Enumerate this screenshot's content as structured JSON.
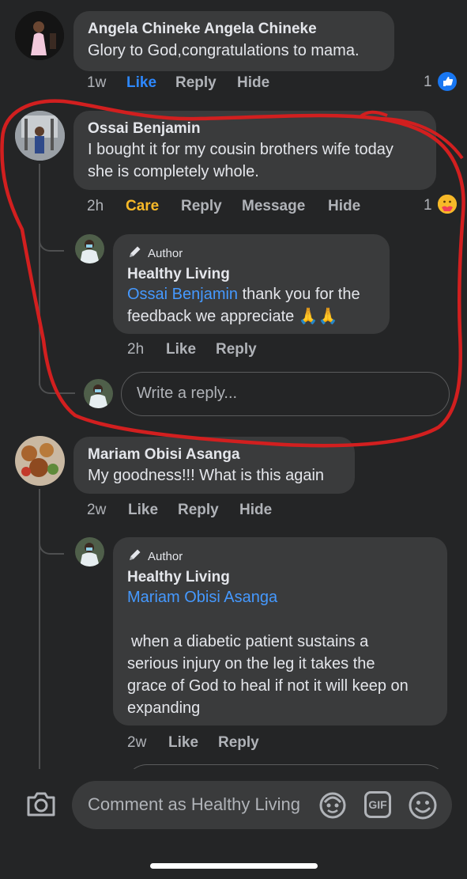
{
  "comments": {
    "c1": {
      "name": "Angela Chineke Angela Chineke",
      "text": "Glory to God,congratulations to mama.",
      "time": "1w",
      "like": "Like",
      "reply": "Reply",
      "hide": "Hide",
      "reaction_count": "1"
    },
    "c2": {
      "name": "Ossai Benjamin",
      "line1": "I bought it for my cousin brothers wife today",
      "line2": "she is completely whole.",
      "time": "2h",
      "care": "Care",
      "reply": "Reply",
      "message": "Message",
      "hide": "Hide",
      "reaction_count": "1"
    },
    "r1": {
      "author_tag": "Author",
      "name": "Healthy Living",
      "mention": "Ossai Benjamin",
      "text_a": " thank you for the",
      "text_b": "feedback we appreciate",
      "emoji": "🙏🙏",
      "time": "2h",
      "like": "Like",
      "reply": "Reply"
    },
    "write_reply": {
      "placeholder": "Write a reply..."
    },
    "c3": {
      "name": "Mariam Obisi Asanga",
      "text": "My goodness!!! What is this again",
      "time": "2w",
      "like": "Like",
      "reply": "Reply",
      "hide": "Hide"
    },
    "r2": {
      "author_tag": "Author",
      "name": "Healthy Living",
      "mention": "Mariam Obisi Asanga",
      "line1": "when a diabetic patient sustains a",
      "line2": "serious injury on the leg it takes the",
      "line3": "grace of God to heal if not it will keep on",
      "line4": "expanding",
      "time": "2w",
      "like": "Like",
      "reply": "Reply"
    }
  },
  "composer": {
    "placeholder": "Comment as Healthy Living",
    "gif_label": "GIF"
  },
  "colors": {
    "annotation": "#d21f1f",
    "link": "#4599ff",
    "like_active": "#2d88ff",
    "care": "#f7b928"
  },
  "icons": {
    "camera": "camera-icon",
    "avatar_sticker": "avatar-sticker-icon",
    "gif": "gif-icon",
    "emoji": "emoji-icon",
    "like_reaction": "like-reaction-icon",
    "care_reaction": "care-reaction-icon",
    "author": "pen-icon"
  }
}
